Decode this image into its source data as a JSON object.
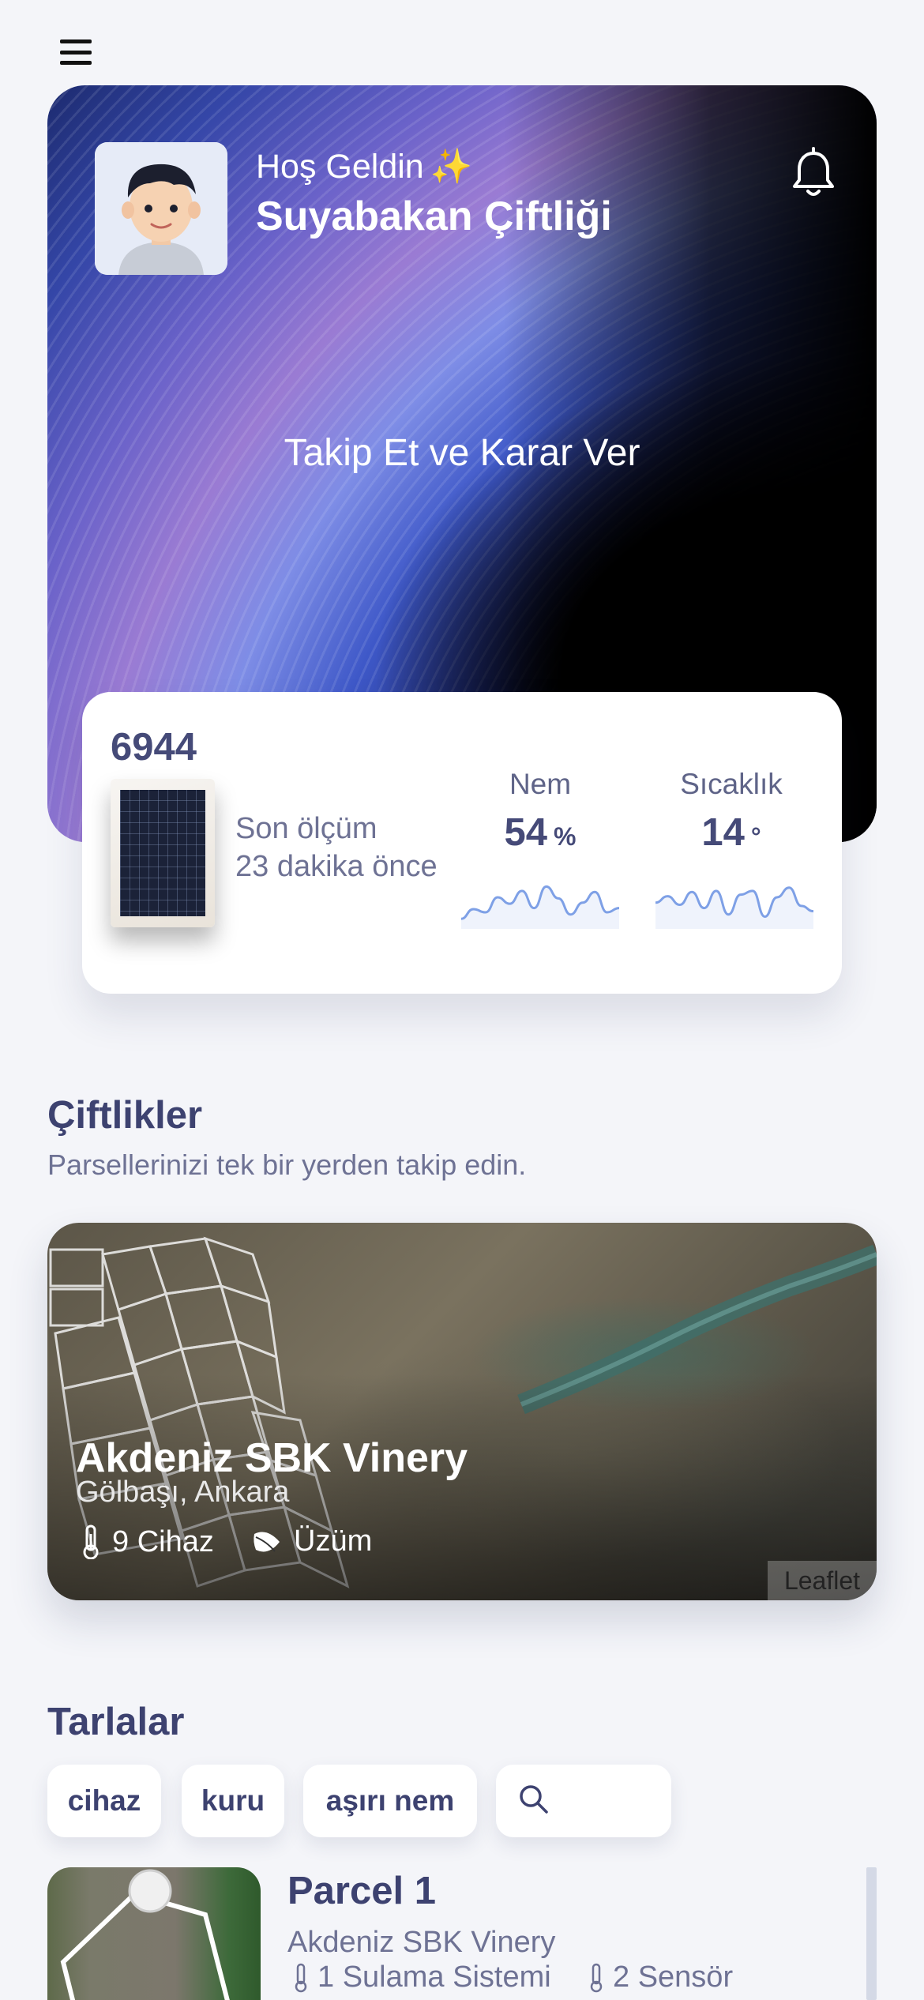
{
  "header": {
    "menu_icon": "hamburger-menu-icon"
  },
  "hero": {
    "greeting": "Hoş Geldin",
    "greeting_emoji": "✨",
    "farm_name": "Suyabakan Çiftliği",
    "tagline": "Takip Et ve Karar Ver",
    "bell_icon": "bell-icon"
  },
  "device": {
    "id": "6944",
    "last_label": "Son ölçüm",
    "last_time": "23 dakika önce",
    "humidity": {
      "label": "Nem",
      "value": "54",
      "unit": "%",
      "trend": [
        10,
        28,
        22,
        50,
        38,
        62,
        30,
        70,
        48,
        18,
        40,
        60,
        22,
        30
      ]
    },
    "temperature": {
      "label": "Sıcaklık",
      "value": "14",
      "unit": "°",
      "trend": [
        40,
        52,
        36,
        60,
        30,
        62,
        18,
        55,
        62,
        14,
        50,
        68,
        34,
        24
      ]
    }
  },
  "farms": {
    "title": "Çiftlikler",
    "subtitle": "Parsellerinizi tek bir yerden takip edin.",
    "card": {
      "name": "Akdeniz SBK Vinery",
      "location": "Gölbaşı, Ankara",
      "devices": "9 Cihaz",
      "crop": "Üzüm",
      "attribution": "Leaflet"
    }
  },
  "fields": {
    "title": "Tarlalar",
    "filters": [
      "cihaz",
      "kuru",
      "aşırı nem"
    ],
    "search_placeholder": "",
    "items": [
      {
        "name": "Parcel 1",
        "farm": "Akdeniz SBK Vinery",
        "irrigation": "1 Sulama Sistemi",
        "sensors": "2 Sensör"
      }
    ]
  },
  "colors": {
    "text_primary": "#3d4270",
    "text_secondary": "#6e7294",
    "chart_line": "#7ea0e6",
    "background": "#f4f5f9"
  }
}
